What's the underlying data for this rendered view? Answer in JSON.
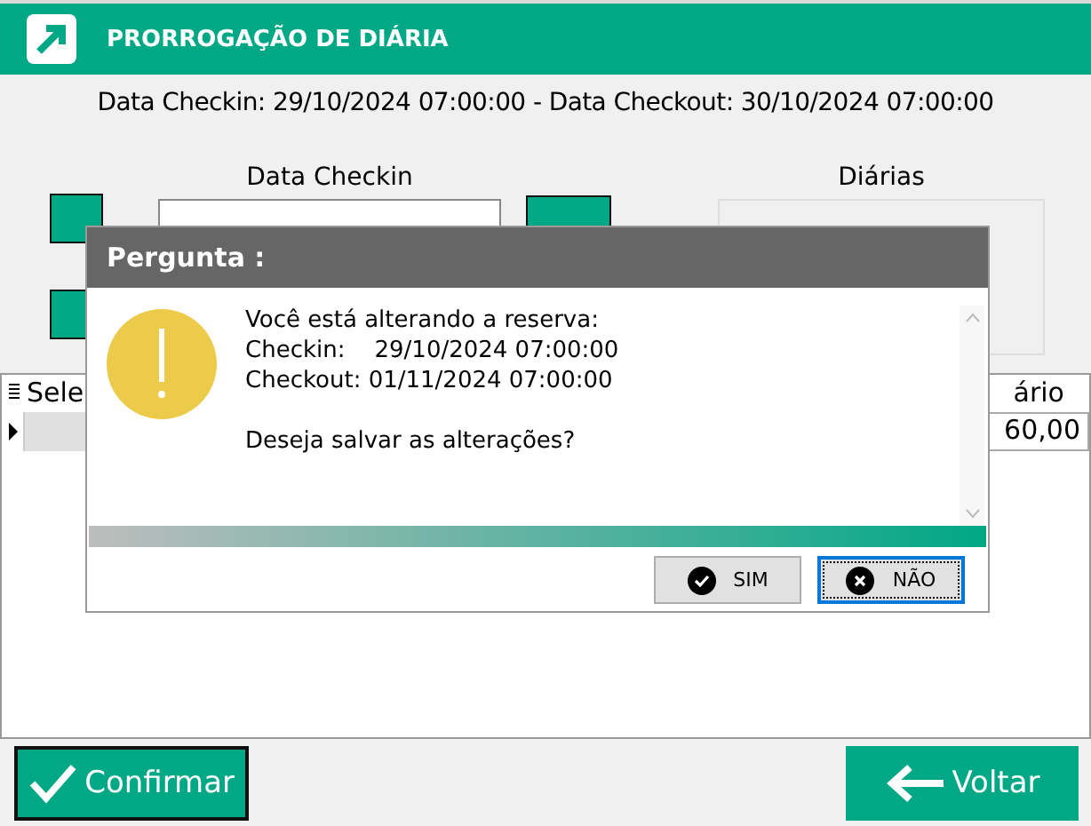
{
  "window": {
    "title": "PRORROGAÇÃO DE DIÁRIA"
  },
  "info": "Data Checkin: 29/10/2024 07:00:00 - Data Checkout: 30/10/2024 07:00:00",
  "checkin": {
    "label": "Data Checkin"
  },
  "diarias": {
    "label": "Diárias"
  },
  "grid": {
    "columns": [
      "Sele",
      "ário"
    ],
    "rows": [
      {
        "selected": true,
        "cells": [
          "",
          "60,00"
        ]
      }
    ]
  },
  "dialog": {
    "title": "Pergunta :",
    "lines": [
      "Você está alterando a reserva:",
      "Checkin:    29/10/2024 07:00:00",
      "Checkout: 01/11/2024 07:00:00"
    ],
    "question": "Deseja salvar as alterações?",
    "buttons": [
      {
        "label": "SIM",
        "kind": "yes",
        "focused": false
      },
      {
        "label": "NÃO",
        "kind": "no",
        "focused": true
      }
    ]
  },
  "footer": {
    "confirm": "Confirmar",
    "back": "Voltar"
  }
}
